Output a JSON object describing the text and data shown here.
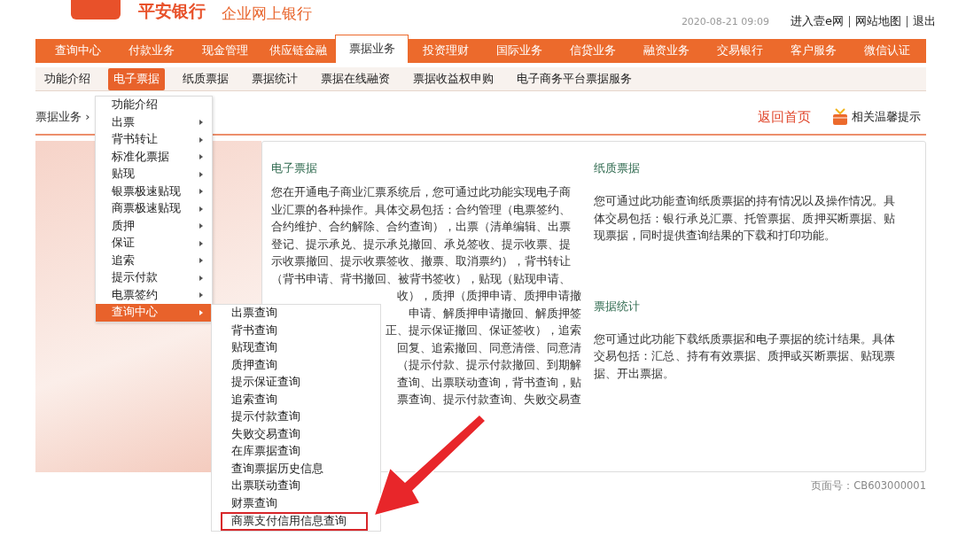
{
  "header": {
    "brand": "平安银行",
    "product": "企业网上银行",
    "datetime": "2020-08-21  09:09",
    "links": [
      "进入壹e网",
      "网站地图",
      "退出"
    ]
  },
  "main_nav": [
    {
      "label": "查询中心",
      "selected": false
    },
    {
      "label": "付款业务",
      "selected": false
    },
    {
      "label": "现金管理",
      "selected": false
    },
    {
      "label": "供应链金融",
      "selected": false
    },
    {
      "label": "票据业务",
      "selected": true
    },
    {
      "label": "投资理财",
      "selected": false
    },
    {
      "label": "国际业务",
      "selected": false
    },
    {
      "label": "信贷业务",
      "selected": false
    },
    {
      "label": "融资业务",
      "selected": false
    },
    {
      "label": "交易银行",
      "selected": false
    },
    {
      "label": "客户服务",
      "selected": false
    },
    {
      "label": "微信认证",
      "selected": false
    }
  ],
  "sub_nav": [
    {
      "label": "功能介绍",
      "selected": false
    },
    {
      "label": "电子票据",
      "selected": true
    },
    {
      "label": "纸质票据",
      "selected": false
    },
    {
      "label": "票据统计",
      "selected": false
    },
    {
      "label": "票据在线融资",
      "selected": false
    },
    {
      "label": "票据收益权申购",
      "selected": false
    },
    {
      "label": "电子商务平台票据服务",
      "selected": false
    }
  ],
  "breadcrumb": "票据业务 ›",
  "home_link": "返回首页",
  "help_link": "相关温馨提示",
  "sections": [
    {
      "title": "电子票据",
      "lines": [
        {
          "text": "您在开通电子商业汇票系统后，您可通过此功能实现电子商",
          "kind": "full"
        },
        {
          "text": "业汇票的各种操作。具体交易包括：合约管理（电票签约、",
          "kind": "full"
        },
        {
          "text": "合约维护、合约解除、合约查询），出票（清单编辑、出票",
          "kind": "full"
        },
        {
          "text": "登记、提示承兑、提示承兑撤回、承兑签收、提示收票、提",
          "kind": "full"
        },
        {
          "text": "示收票撤回、提示收票签收、撤票、取消票约），背书转让",
          "kind": "full"
        },
        {
          "text": "（背书申请、背书撤回、被背书签收），贴现（贴现申请、",
          "kind": "full"
        },
        {
          "text": "收），质押（质押申请、质押申请撤",
          "kind": "partial"
        },
        {
          "text": "申请、解质押申请撤回、解质押签",
          "kind": "partial"
        },
        {
          "text": "正、提示保证撤回、保证签收），追索",
          "kind": "partial"
        },
        {
          "text": "回复、追索撤回、同意清偿、同意清",
          "kind": "partial"
        },
        {
          "text": "（提示付款、提示付款撤回、到期解",
          "kind": "partial"
        },
        {
          "text": "查询、出票联动查询，背书查询，贴",
          "kind": "partial"
        },
        {
          "text": "票查询、提示付款查询、失败交易查",
          "kind": "partial"
        }
      ]
    },
    {
      "title": "纸质票据",
      "lines": [
        {
          "text": "您可通过此功能查询纸质票据的持有情况以及操作情况。具",
          "kind": "full"
        },
        {
          "text": "体交易包括：银行承兑汇票、托管票据、质押买断票据、贴",
          "kind": "full"
        },
        {
          "text": "现票据，同时提供查询结果的下载和打印功能。",
          "kind": "last"
        }
      ]
    },
    {
      "title": "票据统计",
      "lines": [
        {
          "text": "您可通过此功能下载纸质票据和电子票据的统计结果。具体",
          "kind": "full"
        },
        {
          "text": "交易包括：汇总、持有有效票据、质押或买断票据、贴现票",
          "kind": "full"
        },
        {
          "text": "据、开出票据。",
          "kind": "last"
        }
      ]
    }
  ],
  "page_code": "页面号：CB603000001",
  "menu": [
    {
      "label": "功能介绍",
      "submenu": false,
      "selected": false
    },
    {
      "label": "出票",
      "submenu": true,
      "selected": false
    },
    {
      "label": "背书转让",
      "submenu": true,
      "selected": false
    },
    {
      "label": "标准化票据",
      "submenu": true,
      "selected": false
    },
    {
      "label": "贴现",
      "submenu": true,
      "selected": false
    },
    {
      "label": "银票极速贴现",
      "submenu": true,
      "selected": false
    },
    {
      "label": "商票极速贴现",
      "submenu": true,
      "selected": false
    },
    {
      "label": "质押",
      "submenu": true,
      "selected": false
    },
    {
      "label": "保证",
      "submenu": true,
      "selected": false
    },
    {
      "label": "追索",
      "submenu": true,
      "selected": false
    },
    {
      "label": "提示付款",
      "submenu": true,
      "selected": false
    },
    {
      "label": "电票签约",
      "submenu": true,
      "selected": false
    },
    {
      "label": "查询中心",
      "submenu": true,
      "selected": true
    }
  ],
  "submenu": [
    {
      "label": "出票查询",
      "highlighted": false
    },
    {
      "label": "背书查询",
      "highlighted": false
    },
    {
      "label": "贴现查询",
      "highlighted": false
    },
    {
      "label": "质押查询",
      "highlighted": false
    },
    {
      "label": "提示保证查询",
      "highlighted": false
    },
    {
      "label": "追索查询",
      "highlighted": false
    },
    {
      "label": "提示付款查询",
      "highlighted": false
    },
    {
      "label": "失败交易查询",
      "highlighted": false
    },
    {
      "label": "在库票据查询",
      "highlighted": false
    },
    {
      "label": "查询票据历史信息",
      "highlighted": false
    },
    {
      "label": "出票联动查询",
      "highlighted": false
    },
    {
      "label": "财票查询",
      "highlighted": false
    },
    {
      "label": "商票支付信用信息查询",
      "highlighted": true
    }
  ]
}
